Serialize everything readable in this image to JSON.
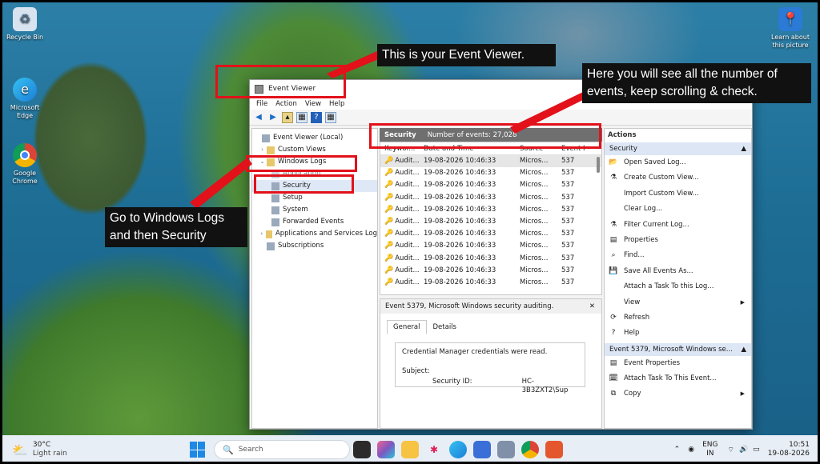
{
  "desktop": {
    "icons": [
      {
        "label": "Recycle Bin"
      },
      {
        "label": "Microsoft Edge"
      },
      {
        "label": "Google Chrome"
      },
      {
        "label": "Learn about this picture"
      }
    ]
  },
  "window": {
    "title": "Event Viewer",
    "menu": [
      "File",
      "Action",
      "View",
      "Help"
    ]
  },
  "tree": {
    "root": "Event Viewer (Local)",
    "custom_views": "Custom Views",
    "windows_logs": "Windows Logs",
    "application": "Application",
    "security": "Security",
    "setup": "Setup",
    "system": "System",
    "forwarded_events": "Forwarded Events",
    "app_services_logs": "Applications and Services Log",
    "subscriptions": "Subscriptions"
  },
  "events": {
    "header_name": "Security",
    "header_count": "Number of events: 27,028",
    "columns": [
      "Keywor...",
      "Date and Time",
      "Source",
      "Event I"
    ],
    "rows": [
      {
        "keyword": "Audit...",
        "date": "19-08-2026 10:46:33",
        "source": "Micros...",
        "id": "537"
      },
      {
        "keyword": "Audit...",
        "date": "19-08-2026 10:46:33",
        "source": "Micros...",
        "id": "537"
      },
      {
        "keyword": "Audit...",
        "date": "19-08-2026 10:46:33",
        "source": "Micros...",
        "id": "537"
      },
      {
        "keyword": "Audit...",
        "date": "19-08-2026 10:46:33",
        "source": "Micros...",
        "id": "537"
      },
      {
        "keyword": "Audit...",
        "date": "19-08-2026 10:46:33",
        "source": "Micros...",
        "id": "537"
      },
      {
        "keyword": "Audit...",
        "date": "19-08-2026 10:46:33",
        "source": "Micros...",
        "id": "537"
      },
      {
        "keyword": "Audit...",
        "date": "19-08-2026 10:46:33",
        "source": "Micros...",
        "id": "537"
      },
      {
        "keyword": "Audit...",
        "date": "19-08-2026 10:46:33",
        "source": "Micros...",
        "id": "537"
      },
      {
        "keyword": "Audit...",
        "date": "19-08-2026 10:46:33",
        "source": "Micros...",
        "id": "537"
      },
      {
        "keyword": "Audit...",
        "date": "19-08-2026 10:46:33",
        "source": "Micros...",
        "id": "537"
      },
      {
        "keyword": "Audit...",
        "date": "19-08-2026 10:46:33",
        "source": "Micros...",
        "id": "537"
      }
    ]
  },
  "detail": {
    "title": "Event 5379, Microsoft Windows security auditing.",
    "close": "✕",
    "tabs": [
      "General",
      "Details"
    ],
    "message": "Credential Manager credentials were read.",
    "subject_label": "Subject:",
    "security_id_label": "Security ID:",
    "security_id_value": "HC-3B3ZXT2\\Sup"
  },
  "actions": {
    "title": "Actions",
    "section1": "Security",
    "items1": [
      "Open Saved Log...",
      "Create Custom View...",
      "Import Custom View...",
      "Clear Log...",
      "Filter Current Log...",
      "Properties",
      "Find...",
      "Save All Events As...",
      "Attach a Task To this Log...",
      "View",
      "Refresh",
      "Help"
    ],
    "section2": "Event 5379, Microsoft Windows se...",
    "items2": [
      "Event Properties",
      "Attach Task To This Event...",
      "Copy"
    ]
  },
  "callouts": {
    "event_viewer": "This is your Event Viewer.",
    "events_count": "Here you will see all the number of events, keep scrolling & check.",
    "windows_logs": "Go to Windows Logs and then Security"
  },
  "taskbar": {
    "temp": "30°C",
    "weather": "Light rain",
    "search": "Search",
    "lang1": "ENG",
    "lang2": "IN",
    "time": "10:51",
    "date": "19-08-2026"
  },
  "colors": {
    "annotation_red": "#e2111a",
    "callout_bg": "#111111",
    "events_header_bg": "#6f6f6f",
    "actions_section_bg": "#dce6f4"
  }
}
